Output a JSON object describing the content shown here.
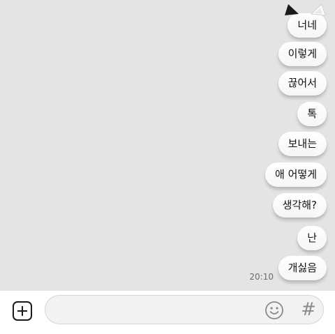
{
  "messages": [
    {
      "text": "너네"
    },
    {
      "text": "이렇게"
    },
    {
      "text": "끊어서"
    },
    {
      "text": "톡"
    },
    {
      "text": "보내는"
    },
    {
      "text": "애 어떻게"
    },
    {
      "text": "생각해?"
    },
    {
      "text": "난"
    },
    {
      "text": "개싫음"
    }
  ],
  "timestamp": "20:10",
  "input": {
    "value": "",
    "placeholder": ""
  },
  "icons": {
    "attach": "plus-square-icon",
    "emoji": "smiley-icon",
    "hashtag": "hash-icon",
    "decoration": "cat-ears-icon"
  },
  "colors": {
    "chat_background": "#e4e4e4",
    "bubble": "#ffffff",
    "timestamp": "#6a6a6a"
  },
  "hash_glyph": "#"
}
